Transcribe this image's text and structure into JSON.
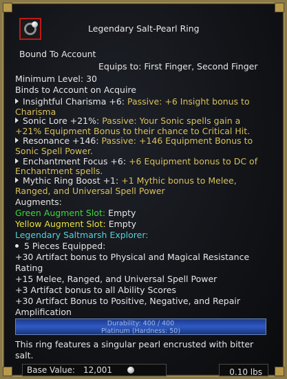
{
  "item": {
    "name": "Legendary Salt-Pearl Ring",
    "icon": "pearl-ring-icon",
    "bound": "Bound To Account",
    "equips": "Equips to: First Finger, Second Finger",
    "min_level": "Minimum Level: 30",
    "binds": "Binds to Account on Acquire"
  },
  "effects": [
    {
      "name": "Insightful Charisma +6:",
      "desc_a": "Passive: +6 Insight bonus to",
      "desc_b": "Charisma"
    },
    {
      "name": "Sonic Lore +21%:",
      "desc_a": "Passive: Your Sonic spells gain a",
      "desc_b": "+21% Equipment Bonus to their chance to Critical Hit."
    },
    {
      "name": "Resonance +146:",
      "desc_a": "Passive: +146 Equipment Bonus to",
      "desc_b": "Sonic Spell Power."
    },
    {
      "name": "Enchantment Focus +6:",
      "desc_a": "+6 Equipment bonus to DC of",
      "desc_b": "Enchantment spells."
    },
    {
      "name": "Mythic Ring Boost +1:",
      "desc_a": "+1 Mythic bonus to Melee,",
      "desc_b": "Ranged, and Universal Spell Power"
    }
  ],
  "augments": {
    "header": "Augments:",
    "green_label": "Green Augment Slot:",
    "green_value": "Empty",
    "yellow_label": "Yellow Augment Slot:",
    "yellow_value": "Empty"
  },
  "set": {
    "name": "Legendary Saltmarsh Explorer:",
    "pieces": "5 Pieces Equipped:",
    "lines": [
      "+30 Artifact bonus to Physical and Magical Resistance",
      "Rating",
      "+15 Melee, Ranged, and Universal Spell Power",
      "+3 Artifact bonus to all Ability Scores",
      "+30 Artifact Bonus to Positive, Negative, and Repair",
      "Amplification"
    ]
  },
  "durability": {
    "text": "Durability: 400 / 400",
    "material": "Platinum (Hardness: 50)",
    "fraction": 1.0
  },
  "description": [
    "This ring features a singular pearl encrusted with bitter",
    "salt."
  ],
  "footer": {
    "base_value_label": "Base Value:",
    "base_value": "12,001",
    "coin_icon": "coin-icon",
    "weight": "0.10 lbs"
  }
}
